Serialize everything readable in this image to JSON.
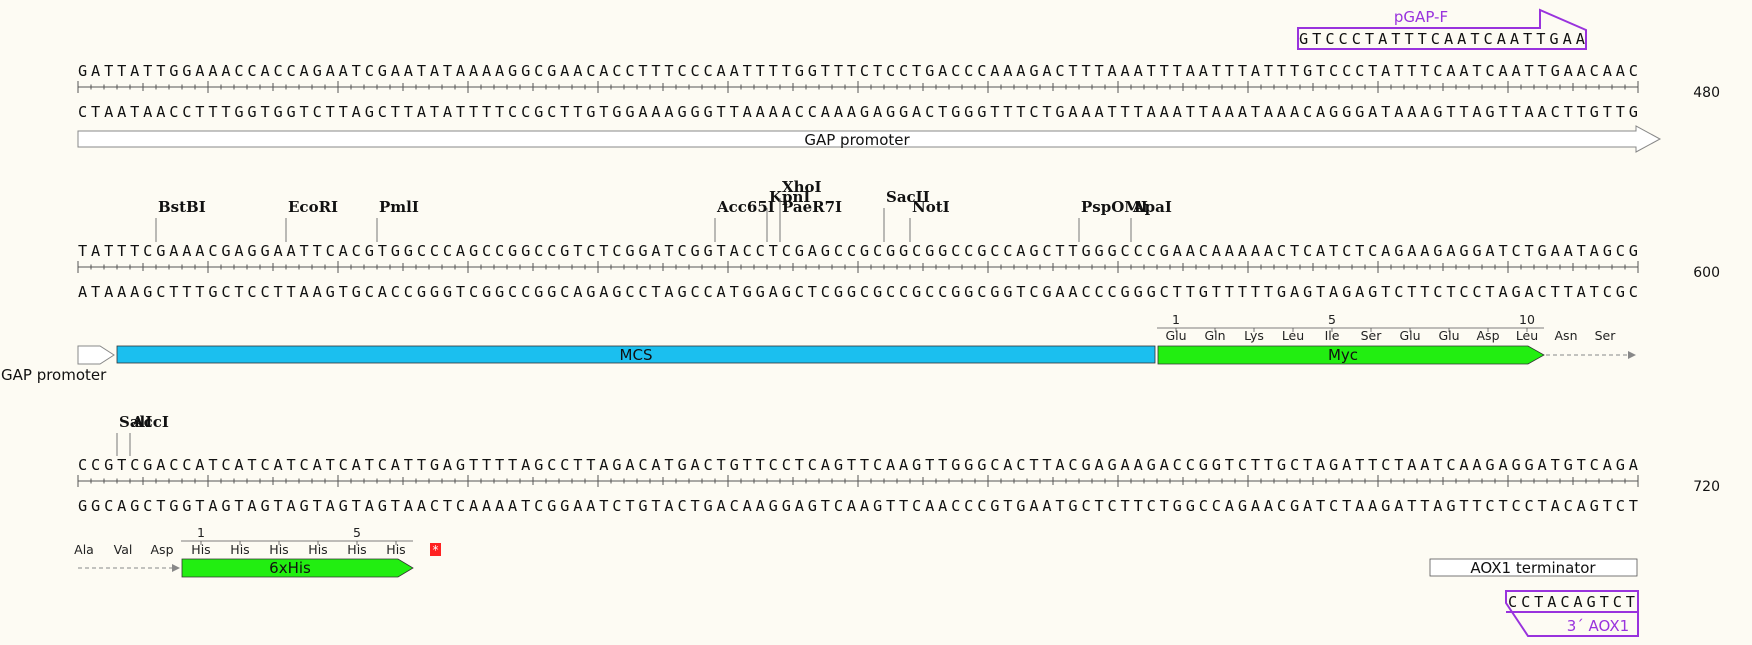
{
  "colors": {
    "background": "#fdfbf3",
    "mcs": "#1bbfef",
    "tag": "#22ee11",
    "primer": "#9933dd",
    "stop": "#ff2222",
    "ruler": "#555555"
  },
  "rows": [
    {
      "top": "GATTATTGGAAACCACCAGAATCGAATATAAAAGGCGAACACCTTTCCCAATTTTGGTTTCTCCTGACCCAAAGACTTTAAATTTAATTTATTTGTCCCTATTTCAATCAATTGAACAAC",
      "bottom": "CTAATAACCTTTGGTGGTCTTAGCTTATATTTTCCGCTTGTGGAAAGGGTTAAAACCAAAGAGGACTGGGTTTCTGAAATTTAAATTAAATAAACAGGGATAAAGTTAGTTAACTTGTTG",
      "position": "480"
    },
    {
      "top": "TATTTCGAAACGAGGAATTCACGTGGCCCAGCCGGCCGTCTCGGATCGGTACCTCGAGCCGCGGCGGCCGCCAGCTTGGGCCCGAACAAAAACTCATCTCAGAAGAGGATCTGAATAGCG",
      "bottom": "ATAAAGCTTTGCTCCTTAAGTGCACCGGGTCGGCCGGCAGAGCCTAGCCATGGAGCTCGGCGCCGCCGGCGGTCGAACCCGGGCTTGTTTTTGAGTAGAGTCTTCTCCTAGACTTATCGC",
      "position": "600"
    },
    {
      "top": "CCGTCGACCATCATCATCATCATCATTGAGTTTTAGCCTTAGACATGACTGTTCCTCAGTTCAAGTTGGGCACTTACGAGAAGACCGGTCTTGCTAGATTCTAATCAAGAGGATGTCAGA",
      "bottom": "GGCAGCTGGTAGTAGTAGTAGTAGTAACTCAAAATCGGAATCTGTACTGACAAGGAGTCAAGTTCAACCCGTGAATGCTCTTCTGGCCAGAACGATCTAAGATTAGTTCTCCTACAGTCT",
      "position": "720"
    }
  ],
  "primers": {
    "forward": {
      "name": "pGAP-F",
      "sequence": "GTCCCTATTTCAATCAATTGAA"
    },
    "reverse": {
      "name": "3´ AOX1",
      "sequence": "CCTACAGTCT"
    }
  },
  "enzymes": [
    {
      "name": "BstBI",
      "row": 1,
      "cut": 6
    },
    {
      "name": "EcoRI",
      "row": 1,
      "cut": 16
    },
    {
      "name": "PmlI",
      "row": 1,
      "cut": 23
    },
    {
      "name": "Acc65I",
      "row": 1,
      "cut": 49
    },
    {
      "name": "KpnI",
      "row": 1,
      "cut": 53
    },
    {
      "name": "XhoI",
      "row": 1,
      "cut": 54
    },
    {
      "name": "PaeR7I",
      "row": 1,
      "cut": 54
    },
    {
      "name": "SacII",
      "row": 1,
      "cut": 62
    },
    {
      "name": "NotI",
      "row": 1,
      "cut": 64
    },
    {
      "name": "PspOMI",
      "row": 1,
      "cut": 77
    },
    {
      "name": "ApaI",
      "row": 1,
      "cut": 81
    },
    {
      "name": "SalI",
      "row": 2,
      "cut": 3
    },
    {
      "name": "AccI",
      "row": 2,
      "cut": 4
    }
  ],
  "features": {
    "gap_promoter": "GAP promoter",
    "mcs": "MCS",
    "myc": "Myc",
    "his": "6xHis",
    "aox1": "AOX1 terminator"
  },
  "translations": {
    "myc_aa": [
      "Glu",
      "Gln",
      "Lys",
      "Leu",
      "Ile",
      "Ser",
      "Glu",
      "Glu",
      "Asp",
      "Leu",
      "Asn",
      "Ser"
    ],
    "myc_numbers": [
      "1",
      "5",
      "10"
    ],
    "his_prefix": [
      "Ala",
      "Val",
      "Asp"
    ],
    "his_aa": [
      "His",
      "His",
      "His",
      "His",
      "His",
      "His"
    ],
    "his_numbers": [
      "1",
      "5"
    ],
    "stop_symbol": "*"
  }
}
